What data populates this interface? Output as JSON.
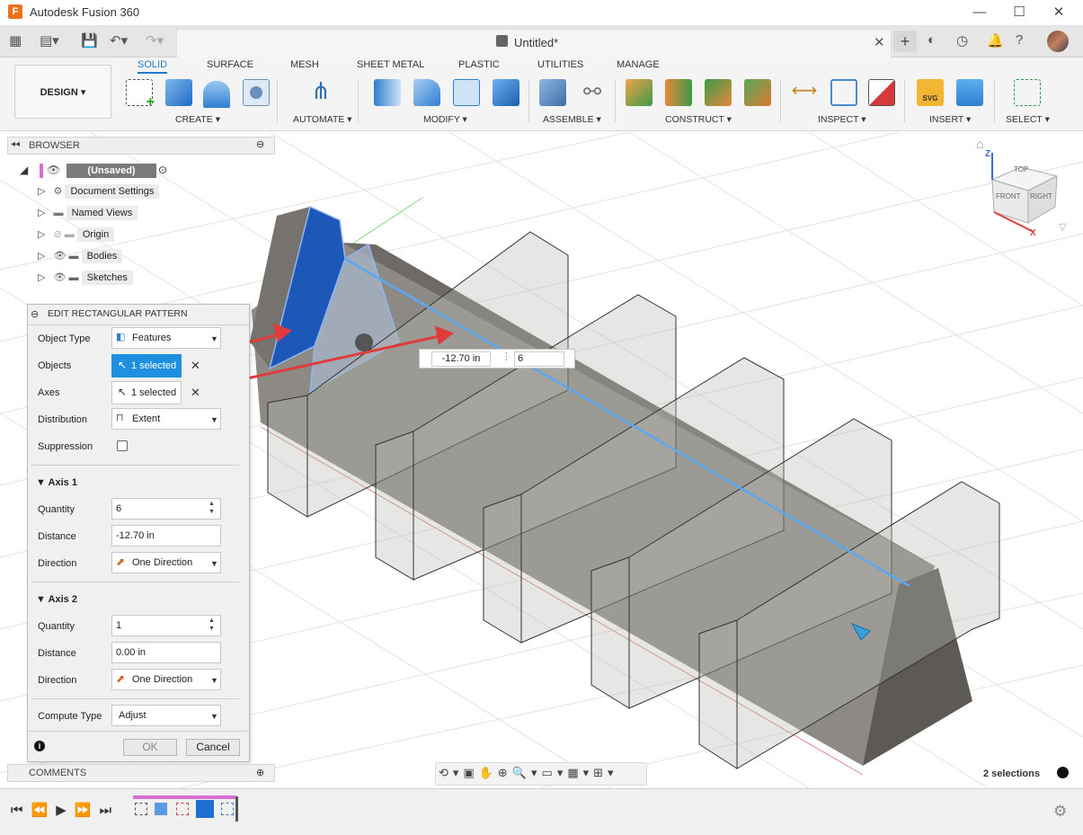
{
  "app": {
    "title": "Autodesk Fusion 360",
    "logo_letter": "F"
  },
  "document": {
    "title": "Untitled*"
  },
  "ribbon": {
    "workspace": "DESIGN ▾",
    "tabs": [
      "SOLID",
      "SURFACE",
      "MESH",
      "SHEET METAL",
      "PLASTIC",
      "UTILITIES",
      "MANAGE"
    ],
    "groups": [
      "CREATE ▾",
      "AUTOMATE ▾",
      "MODIFY ▾",
      "ASSEMBLE ▾",
      "CONSTRUCT ▾",
      "INSPECT ▾",
      "INSERT ▾",
      "SELECT ▾"
    ]
  },
  "browser": {
    "title": "BROWSER",
    "root": "(Unsaved)",
    "items": [
      "Document Settings",
      "Named Views",
      "Origin",
      "Bodies",
      "Sketches"
    ]
  },
  "dialog": {
    "title": "EDIT RECTANGULAR PATTERN",
    "object_type_label": "Object Type",
    "object_type_value": "Features",
    "objects_label": "Objects",
    "objects_value": "1 selected",
    "axes_label": "Axes",
    "axes_value": "1 selected",
    "distribution_label": "Distribution",
    "distribution_value": "Extent",
    "suppression_label": "Suppression",
    "axis1": {
      "title": "Axis 1",
      "quantity_label": "Quantity",
      "quantity": "6",
      "distance_label": "Distance",
      "distance": "-12.70 in",
      "direction_label": "Direction",
      "direction": "One Direction"
    },
    "axis2": {
      "title": "Axis 2",
      "quantity_label": "Quantity",
      "quantity": "1",
      "distance_label": "Distance",
      "distance": "0.00 in",
      "direction_label": "Direction",
      "direction": "One Direction"
    },
    "compute_type_label": "Compute Type",
    "compute_type": "Adjust",
    "ok": "OK",
    "cancel": "Cancel"
  },
  "float_input": {
    "distance": "-12.70 in",
    "quantity": "6"
  },
  "viewcube": {
    "top": "TOP",
    "front": "FRONT",
    "right": "RIGHT",
    "z": "Z",
    "x": "X"
  },
  "comments": {
    "title": "COMMENTS"
  },
  "status": {
    "selections": "2 selections"
  },
  "colors": {
    "accent": "#1e7bd0",
    "selected_blue": "#1f8fe0",
    "body": "#8d8a85",
    "arrow": "#e03a3a"
  }
}
